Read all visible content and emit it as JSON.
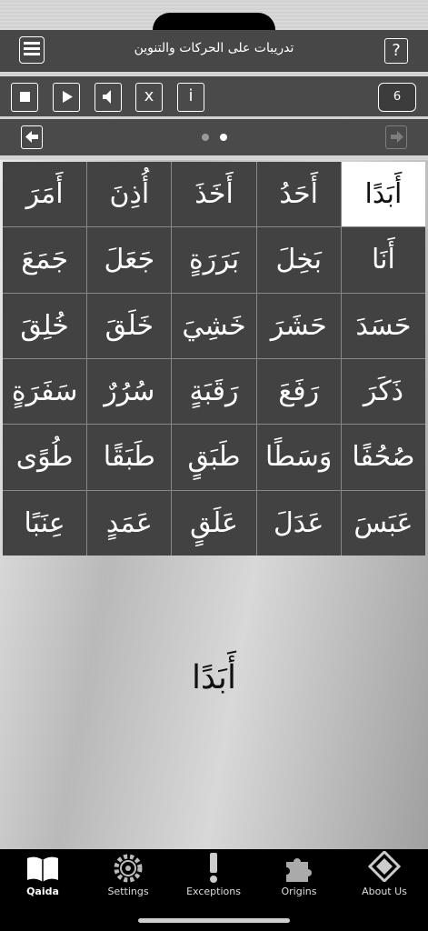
{
  "header": {
    "title": "تدريبات على الحركات والتنوين",
    "help_label": "?"
  },
  "toolbar": {
    "stop_icon": "stop-icon",
    "play_icon": "play-icon",
    "speaker_icon": "speaker-icon",
    "x_label": "x",
    "info_label": "i",
    "count": "6"
  },
  "navigation": {
    "back_icon": "arrow-left-icon",
    "forward_icon": "arrow-right-icon",
    "page_index": 2,
    "page_total": 2
  },
  "grid": {
    "rows": [
      [
        "أَبَدًا",
        "أَحَدُ",
        "أَخَذَ",
        "أُذِنَ",
        "أَمَرَ"
      ],
      [
        "أَنَا",
        "بَخِلَ",
        "بَرَرَةٍ",
        "جَعَلَ",
        "جَمَعَ"
      ],
      [
        "حَسَدَ",
        "حَشَرَ",
        "خَشِيَ",
        "خَلَقَ",
        "خُلِقَ"
      ],
      [
        "ذَكَرَ",
        "رَفَعَ",
        "رَقَبَةٍ",
        "سُرُرٌ",
        "سَفَرَةٍ"
      ],
      [
        "صُحُفًا",
        "وَسَطًا",
        "طَبَقٍ",
        "طَبَقًا",
        "طُوًى"
      ],
      [
        "عَبَسَ",
        "عَدَلَ",
        "عَلَقٍ",
        "عَمَدٍ",
        "عِنَبًا"
      ]
    ],
    "selected": "أَبَدًا"
  },
  "display": {
    "word": "أَبَدًا"
  },
  "tabs": [
    {
      "label": "Qaida",
      "icon": "book-icon",
      "active": true
    },
    {
      "label": "Settings",
      "icon": "gear-icon",
      "active": false
    },
    {
      "label": "Exceptions",
      "icon": "exclamation-icon",
      "active": false
    },
    {
      "label": "Origins",
      "icon": "puzzle-icon",
      "active": false
    },
    {
      "label": "About Us",
      "icon": "diamond-icon",
      "active": false
    }
  ]
}
